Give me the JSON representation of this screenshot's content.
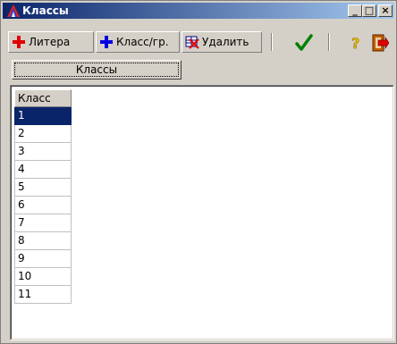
{
  "window": {
    "title": "Классы",
    "minimize": "_",
    "maximize": "□",
    "close": "×"
  },
  "toolbar": {
    "liter_label": "Литера",
    "class_group_label": "Класс/гр.",
    "delete_label": "Удалить",
    "plus_red": "#e00000",
    "plus_blue": "#0000e0",
    "check_color": "#008000"
  },
  "tab": {
    "label": "Классы"
  },
  "grid": {
    "header": "Класс",
    "rows": [
      "1",
      "2",
      "3",
      "4",
      "5",
      "6",
      "7",
      "8",
      "9",
      "10",
      "11"
    ],
    "selected_index": 0
  }
}
